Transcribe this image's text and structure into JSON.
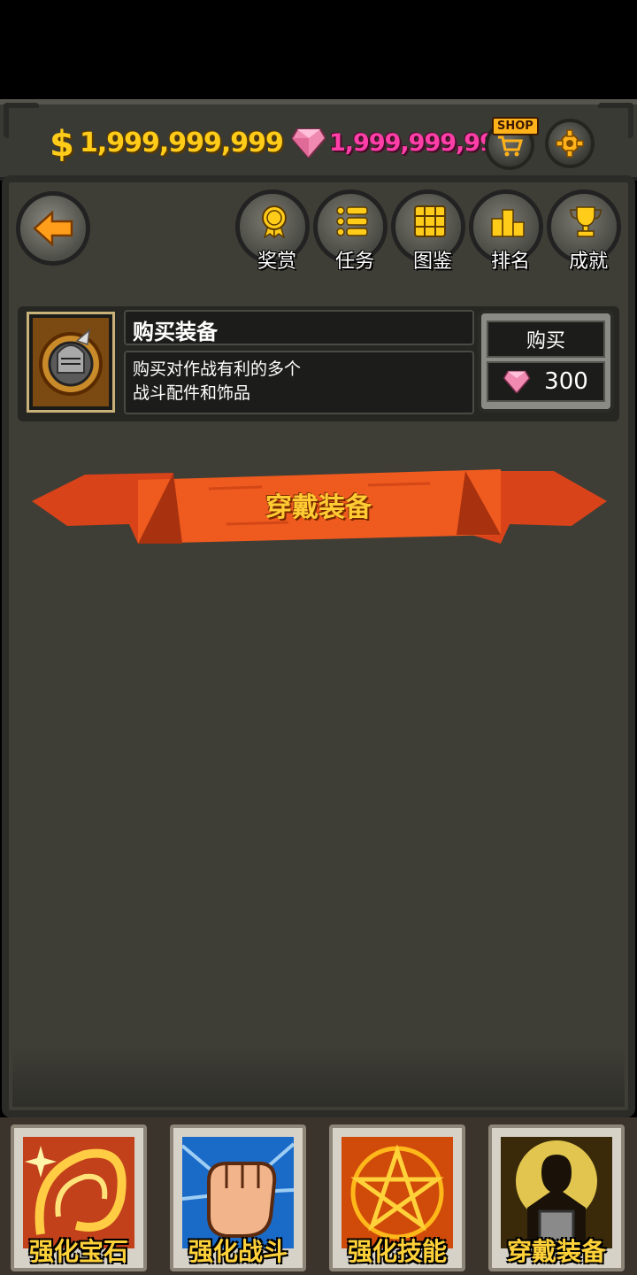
{
  "currency": {
    "gold": "1,999,999,999",
    "gems": "1,999,999,999",
    "shop_label": "SHOP"
  },
  "nav": {
    "items": [
      {
        "label": "奖赏",
        "icon": "medal-icon"
      },
      {
        "label": "任务",
        "icon": "list-icon"
      },
      {
        "label": "图鉴",
        "icon": "grid-icon"
      },
      {
        "label": "排名",
        "icon": "podium-icon"
      },
      {
        "label": "成就",
        "icon": "trophy-icon"
      }
    ]
  },
  "item": {
    "title": "购买装备",
    "desc_line1": "购买对作战有利的多个",
    "desc_line2": "战斗配件和饰品",
    "buy_label": "购买",
    "price": "300"
  },
  "ribbon": {
    "label": "穿戴装备"
  },
  "tabs": [
    {
      "label": "强化宝石",
      "icon": "gem-swirl-icon"
    },
    {
      "label": "强化战斗",
      "icon": "fist-icon"
    },
    {
      "label": "强化技能",
      "icon": "pentagram-icon"
    },
    {
      "label": "穿戴装备",
      "icon": "hero-silhouette-icon"
    }
  ],
  "colors": {
    "gold": "#ffcc1a",
    "gem": "#ff3fa8",
    "ribbon": "#e8501a",
    "panel": "#3e3d36"
  }
}
